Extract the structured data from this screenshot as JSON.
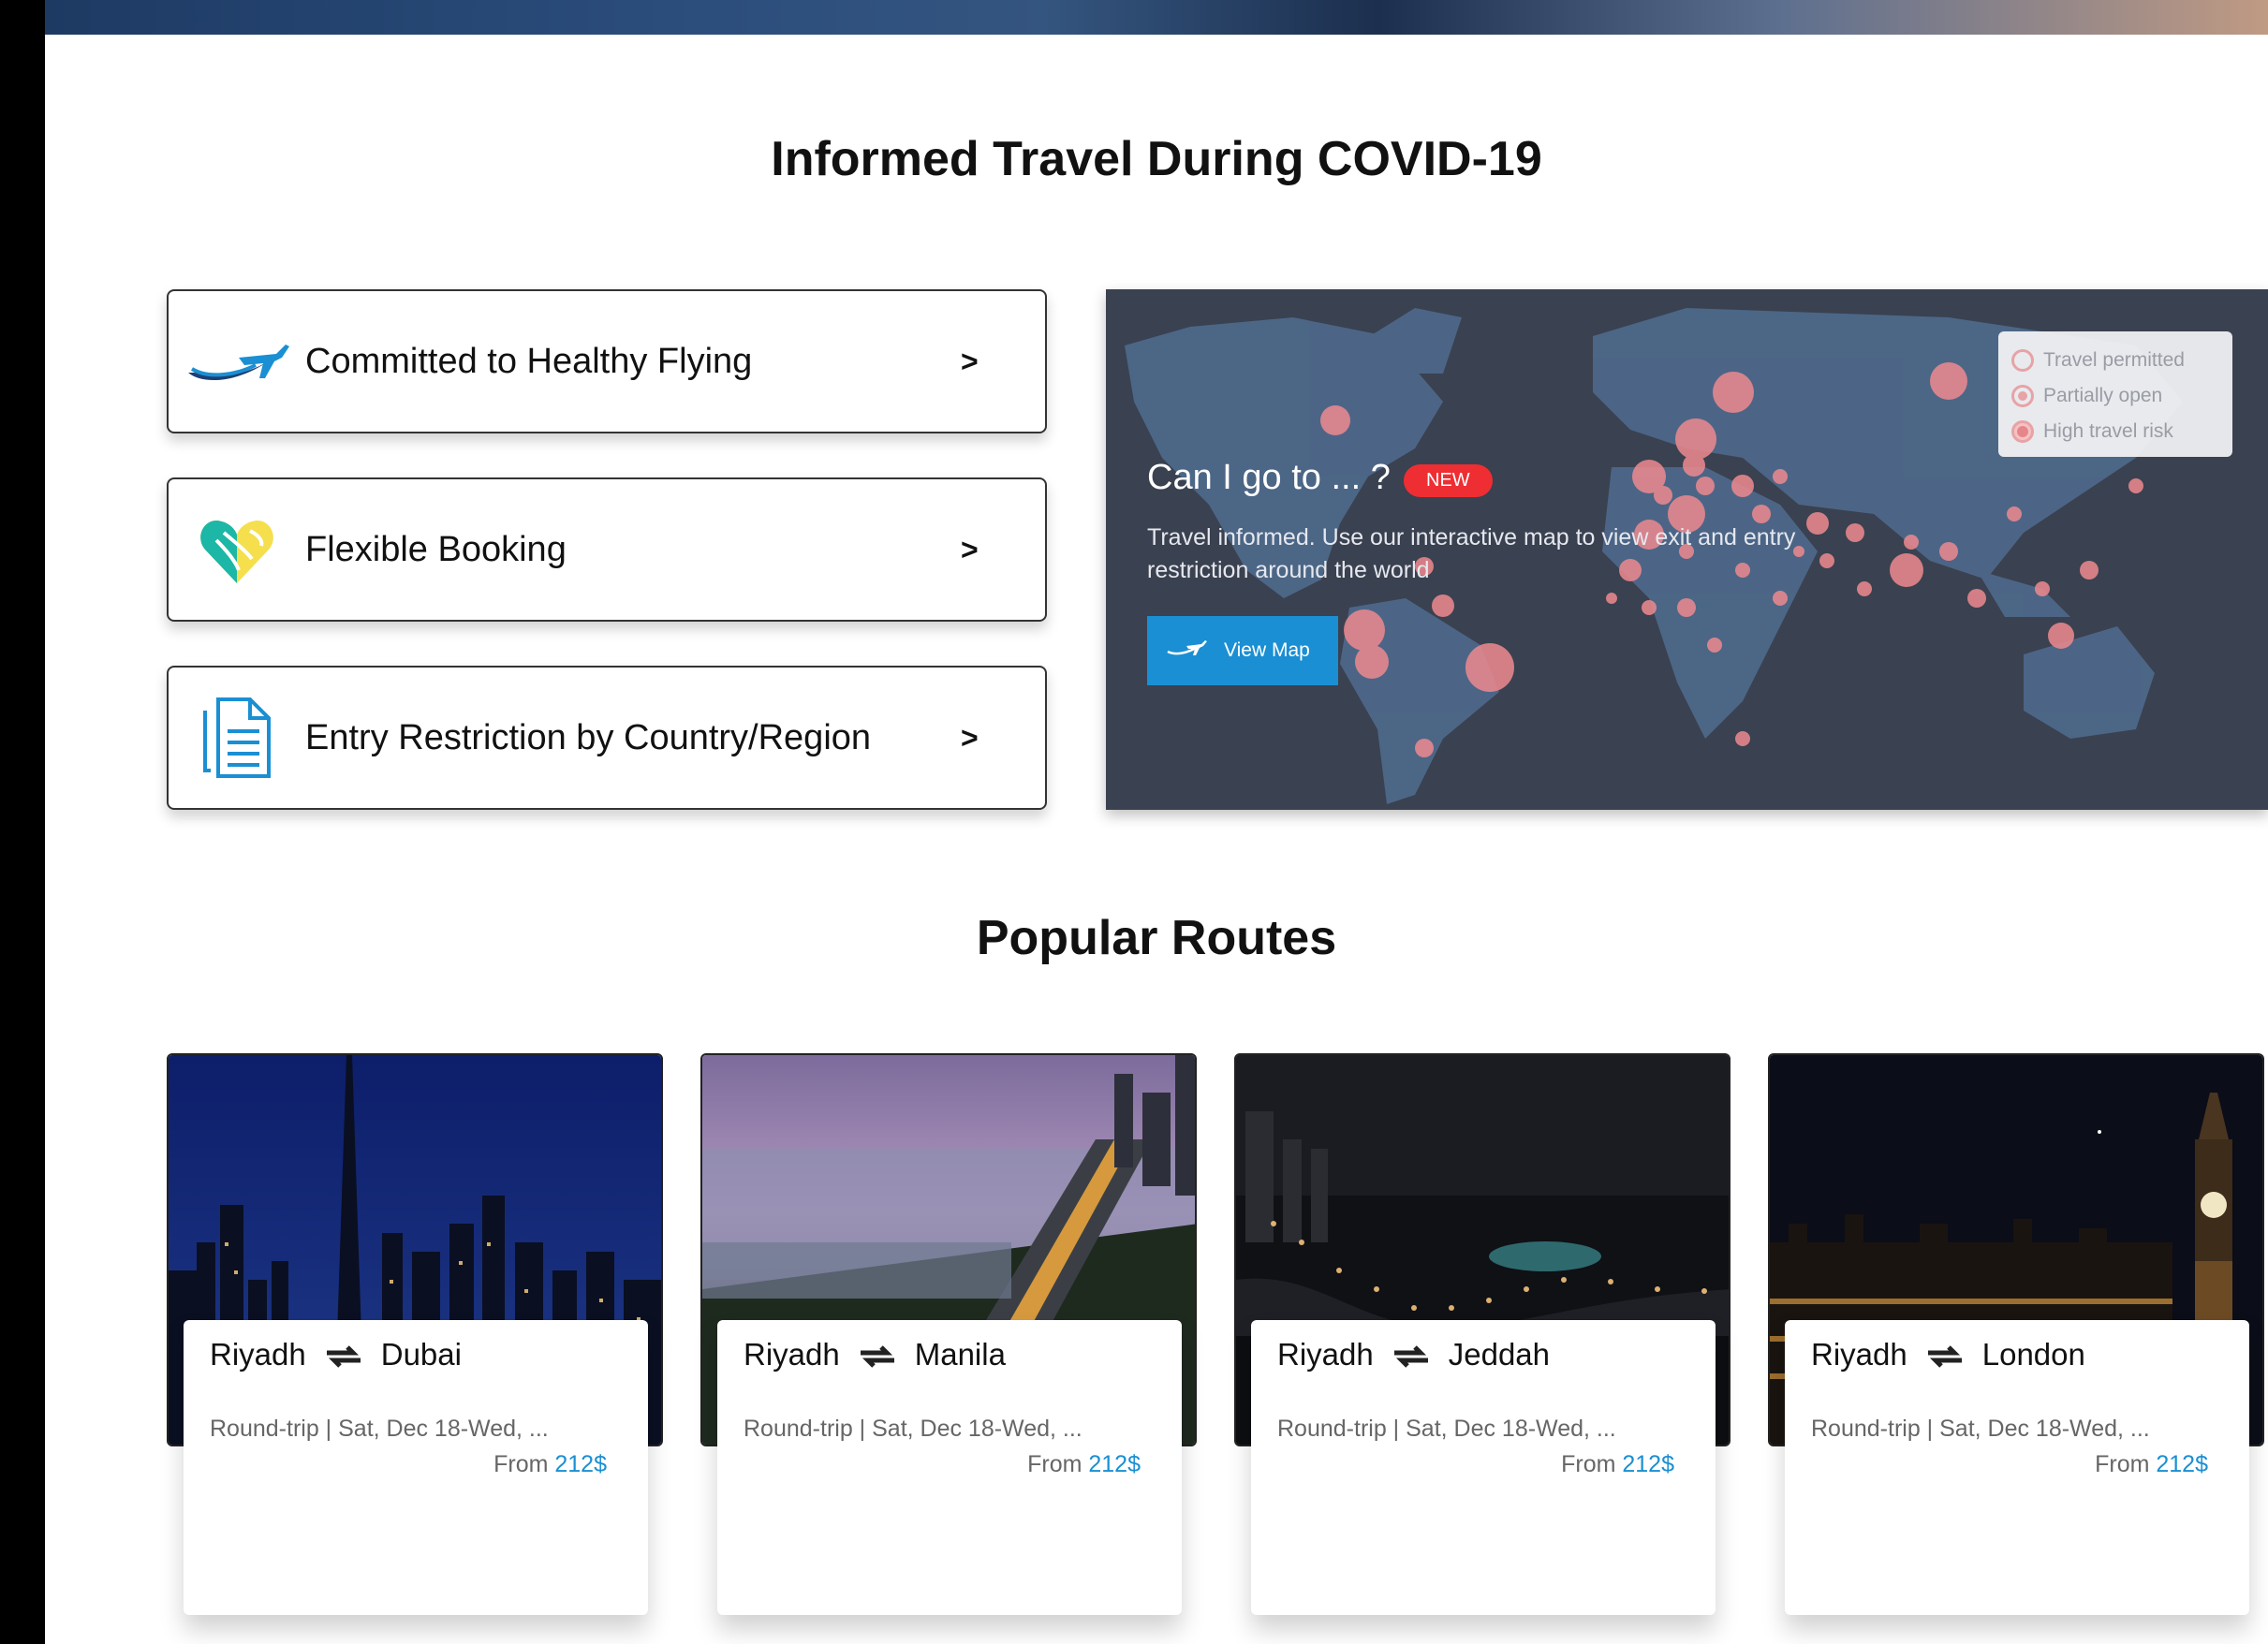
{
  "covid_section": {
    "title": "Informed Travel During COVID-19",
    "cards": [
      {
        "label": "Committed to Healthy Flying",
        "chevron": ">"
      },
      {
        "label": "Flexible Booking",
        "chevron": ">"
      },
      {
        "label": "Entry Restriction by Country/Region",
        "chevron": ">"
      }
    ]
  },
  "map_panel": {
    "heading": "Can I go to ... ?",
    "badge": "NEW",
    "description": "Travel informed. Use our interactive map to view exit and entry restriction around the world",
    "button_label": "View Map",
    "legend": [
      "Travel permitted",
      "Partially open",
      "High travel risk"
    ]
  },
  "routes_section": {
    "title": "Popular Routes",
    "routes": [
      {
        "from": "Riyadh",
        "to": "Dubai",
        "meta": "Round-trip | Sat, Dec 18-Wed, ...",
        "price_prefix": "From",
        "price": "212$"
      },
      {
        "from": "Riyadh",
        "to": "Manila",
        "meta": "Round-trip | Sat, Dec 18-Wed, ...",
        "price_prefix": "From",
        "price": "212$"
      },
      {
        "from": "Riyadh",
        "to": "Jeddah",
        "meta": "Round-trip | Sat, Dec 18-Wed, ...",
        "price_prefix": "From",
        "price": "212$"
      },
      {
        "from": "Riyadh",
        "to": "London",
        "meta": "Round-trip | Sat, Dec 18-Wed, ...",
        "price_prefix": "From",
        "price": "212$"
      }
    ]
  },
  "colors": {
    "accent": "#1a8fd3",
    "badge": "#ee2e32",
    "map_bg": "#3a4150"
  },
  "icons": [
    "plane-swoosh-icon",
    "heart-icon",
    "document-icon",
    "swap-arrows-icon"
  ]
}
